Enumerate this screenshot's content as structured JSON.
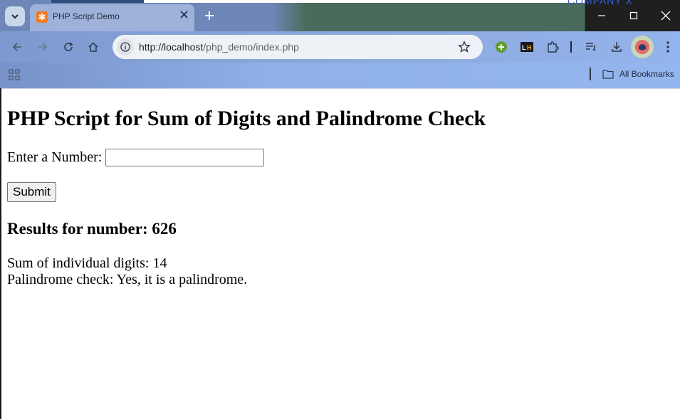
{
  "browser": {
    "tab_title": "PHP Script Demo",
    "url_host": "http://localhost",
    "url_path": "/php_demo/index.php",
    "bookmarks_label": "All Bookmarks",
    "background_snippet": "COMPANY X",
    "colors": {
      "titlebar_left": "#6f86b8",
      "titlebar_right": "#4a6b5c",
      "toolbar": "#8eaadf",
      "favicon": "#f47b20"
    },
    "icons": [
      "tab-search-icon",
      "xampp-favicon-icon",
      "close-icon",
      "plus-icon",
      "minimize-icon",
      "maximize-icon",
      "window-close-icon",
      "back-arrow-icon",
      "forward-arrow-icon",
      "reload-icon",
      "home-icon",
      "info-icon",
      "star-icon",
      "green-plus-extension-icon",
      "lighthouse-extension-icon",
      "puzzle-icon",
      "reading-list-icon",
      "download-icon",
      "profile-avatar-icon",
      "more-vert-icon",
      "apps-grid-icon",
      "folder-icon"
    ]
  },
  "page": {
    "heading": "PHP Script for Sum of Digits and Palindrome Check",
    "input_label": "Enter a Number:",
    "input_value": "",
    "submit_label": "Submit",
    "results_heading": "Results for number: 626",
    "sum_line": "Sum of individual digits: 14",
    "palindrome_line": "Palindrome check: Yes, it is a palindrome."
  }
}
